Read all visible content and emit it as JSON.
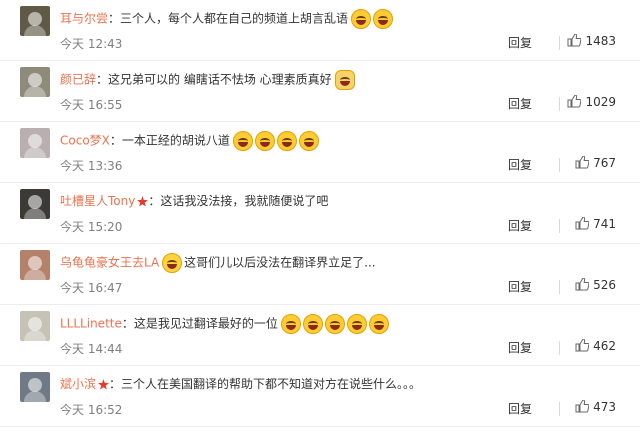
{
  "comments": [
    {
      "name": "耳与尔尝",
      "vip": false,
      "text": "：三个人，每个人都在自己的频道上胡言乱语",
      "emoji": [
        "laugh-cry",
        "laugh-cry"
      ],
      "time": "今天 12:43",
      "reply": "回复",
      "likes": "1483",
      "avatar_color": "#5f5a45"
    },
    {
      "name": "颜已辞",
      "vip": false,
      "text": "：这兄弟可以的 编瞎话不怯场 心理素质真好",
      "emoji": [
        "cat-smile"
      ],
      "time": "今天 16:55",
      "reply": "回复",
      "likes": "1029",
      "avatar_color": "#8f8b7a"
    },
    {
      "name": "Coco梦X",
      "vip": false,
      "text": "：一本正经的胡说八道",
      "emoji": [
        "laugh-cry",
        "laugh-cry",
        "laugh-cry",
        "laugh-cry"
      ],
      "time": "今天 13:36",
      "reply": "回复",
      "likes": "767",
      "avatar_color": "#b9aeb0"
    },
    {
      "name": "吐槽星人Tony",
      "vip": true,
      "text": "：这话我没法接，我就随便说了吧",
      "emoji": [],
      "time": "今天 15:20",
      "reply": "回复",
      "likes": "741",
      "avatar_color": "#3b3a36"
    },
    {
      "name": "乌龟龟豪女王去LA",
      "vip": false,
      "text": "这哥们儿以后没法在翻译界立足了...",
      "emoji_before": [
        "shush"
      ],
      "emoji": [],
      "time": "今天 16:47",
      "reply": "回复",
      "likes": "526",
      "avatar_color": "#b4826a"
    },
    {
      "name": "LLLLinette",
      "vip": false,
      "text": "：这是我见过翻译最好的一位",
      "emoji": [
        "laugh-cry",
        "laugh-cry",
        "laugh-cry",
        "laugh-cry",
        "laugh-cry"
      ],
      "time": "今天 14:44",
      "reply": "回复",
      "likes": "462",
      "avatar_color": "#c7c2b6"
    },
    {
      "name": "斌小滨",
      "vip": true,
      "text": "：三个人在美国翻译的帮助下都不知道对方在说些什么。。。",
      "emoji": [],
      "time": "今天 16:52",
      "reply": "回复",
      "likes": "473",
      "avatar_color": "#6f7a86"
    }
  ]
}
